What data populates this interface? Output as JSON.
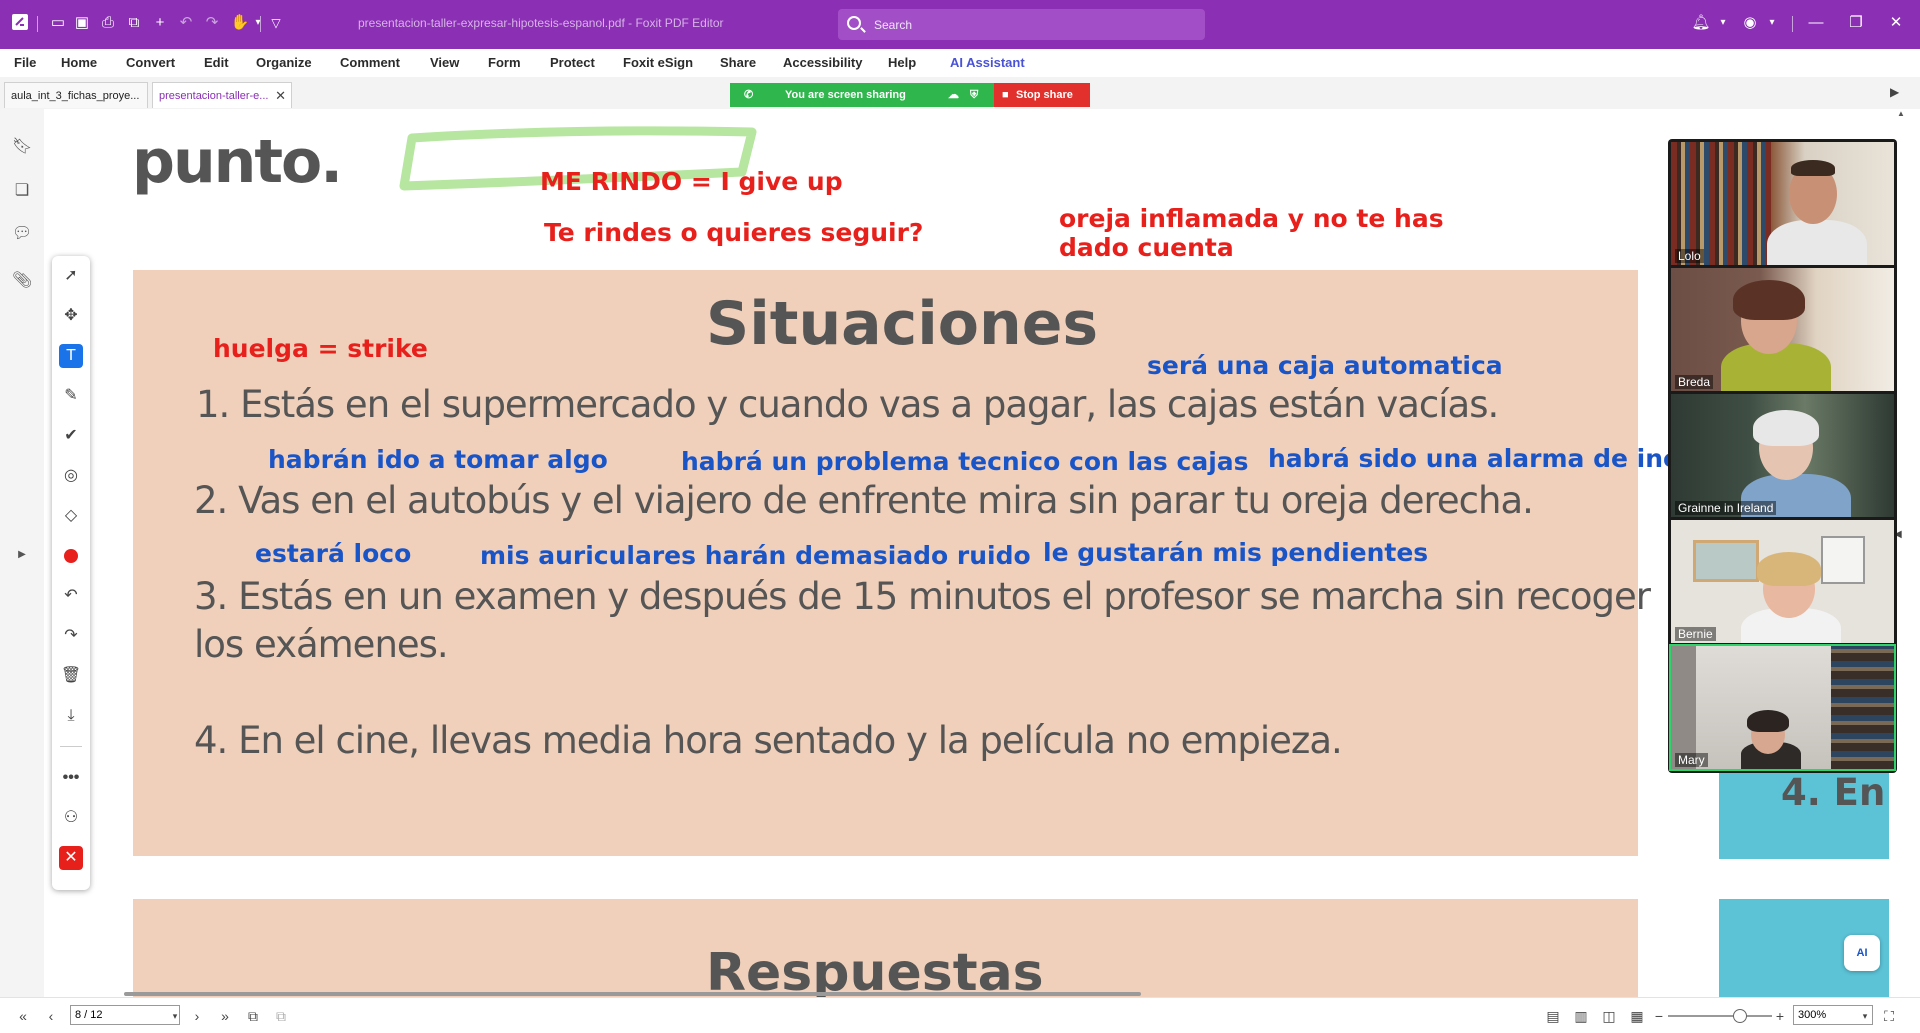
{
  "titlebar": {
    "document_title": "presentacion-taller-expresar-hipotesis-espanol.pdf - Foxit PDF Editor",
    "search_placeholder": "Search"
  },
  "menu": [
    "File",
    "Home",
    "Convert",
    "Edit",
    "Organize",
    "Comment",
    "View",
    "Form",
    "Protect",
    "Foxit eSign",
    "Share",
    "Accessibility",
    "Help",
    "AI Assistant"
  ],
  "tabs": [
    {
      "label": "aula_int_3_fichas_proye...",
      "active": false
    },
    {
      "label": "presentacion-taller-e...",
      "active": true
    }
  ],
  "screen_share": {
    "status": "You are screen sharing",
    "stop_label": "Stop share"
  },
  "slide": {
    "top_word": "punto.",
    "heading": "Situaciones",
    "items": [
      "1. Estás en el supermercado y cuando vas a pagar, las cajas están vacías.",
      "2. Vas en el autobús y el viajero de enfrente mira sin parar tu oreja derecha.",
      "3. Estás en un examen y después de 15 minutos el profesor se marcha sin recoger",
      "los exámenes.",
      "4. En el cine, llevas media hora sentado y la película no empieza."
    ],
    "next_heading": "Respuestas",
    "side_item": "4. En"
  },
  "annotations": {
    "me_rindo": "ME RINDO = I give up",
    "te_rindes": "Te rindes o quieres seguir?",
    "oreja_1": "oreja inflamada y no te has",
    "oreja_2": "dado cuenta",
    "huelga": "huelga = strike",
    "caja": "será una caja automatica",
    "ido": "habrán ido a tomar algo",
    "problema": "habrá un problema tecnico con las cajas",
    "alarma": "habrá sido una alarma de ince",
    "loco": "estará loco",
    "auriculares": "mis auriculares harán demasiado ruido",
    "pendientes": "le gustarán mis pendientes"
  },
  "participants": [
    {
      "name": "Lolo",
      "speaking": false
    },
    {
      "name": "Breda",
      "speaking": false
    },
    {
      "name": "Grainne in Ireland",
      "speaking": false
    },
    {
      "name": "Bernie",
      "speaking": false
    },
    {
      "name": "Mary",
      "speaking": true
    }
  ],
  "bottombar": {
    "page_value": "8 / 12",
    "zoom_value": "300%"
  },
  "colors": {
    "titlebar": "#8b2fb4",
    "slide_bg": "#f0d0bb",
    "annotation_red": "#e8201c",
    "annotation_blue": "#1a55c8",
    "highlight_green": "#b6e6a0",
    "share_green": "#2fb64d",
    "share_red": "#e2302c",
    "next_slide_cyan": "#5cc3d7"
  }
}
